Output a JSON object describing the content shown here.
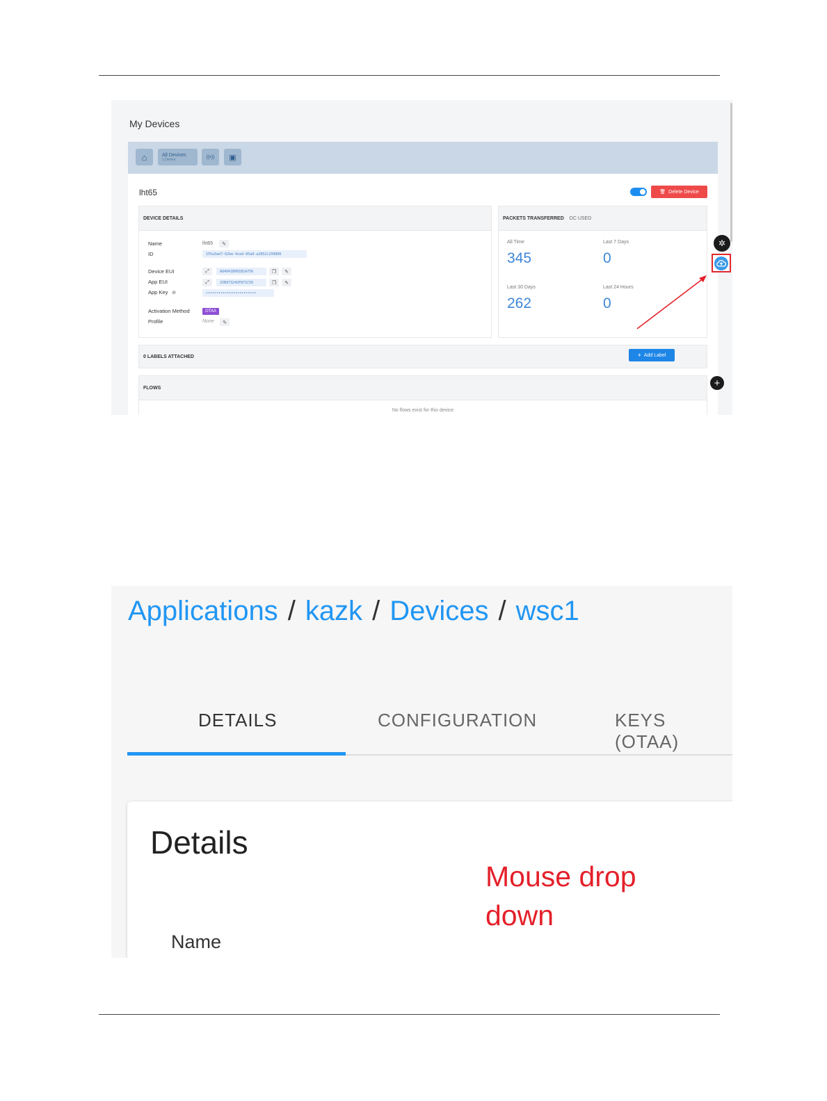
{
  "screenshot1": {
    "page_title": "My Devices",
    "toolbar": {
      "home_label": "⌂",
      "all_devices_label": "All Devices",
      "all_devices_count": "1 Device",
      "hotspot_label": "((•))",
      "folder_label": "▣"
    },
    "device_name": "lht65",
    "delete_label": "Delete Device",
    "device_details": {
      "heading": "DEVICE DETAILS",
      "name_label": "Name",
      "name_value": "lht65",
      "id_label": "ID",
      "id_value": "155a3ad7-62be-4ced-85a8-a2852c299806",
      "dev_eui_label": "Device EUI",
      "dev_eui_value": "A84041B001B1A756",
      "app_eui_label": "App EUI",
      "app_eui_value": "25B97324SF871C56",
      "app_key_label": "App Key",
      "app_key_value": "••••••••••••••••••••••••",
      "activation_label": "Activation Method",
      "activation_value": "OTAA",
      "profile_label": "Profile",
      "profile_value": "None"
    },
    "packets": {
      "heading": "PACKETS TRANSFERRED",
      "dc_used": "DC USED",
      "all_time_label": "All Time",
      "all_time_value": "345",
      "last7_label": "Last 7 Days",
      "last7_value": "0",
      "last30_label": "Last 30 Days",
      "last30_value": "262",
      "last24_label": "Last 24 Hours",
      "last24_value": "0"
    },
    "labels_heading": "0 LABELS ATTACHED",
    "add_label": "Add Label",
    "flows_heading": "FLOWS",
    "no_flows": "No flows exist for this device"
  },
  "screenshot2": {
    "breadcrumb": [
      "Applications",
      "kazk",
      "Devices",
      "wsc1"
    ],
    "tabs": [
      "DETAILS",
      "CONFIGURATION",
      "KEYS (OTAA)"
    ],
    "details_title": "Details",
    "annotation_line1": "Mouse drop",
    "annotation_line2": "down",
    "name_label": "Name"
  },
  "colors": {
    "accent": "#2196f3",
    "delete": "#ef4a4a",
    "annotation": "#e4202a",
    "otaa": "#8e4fd6"
  }
}
